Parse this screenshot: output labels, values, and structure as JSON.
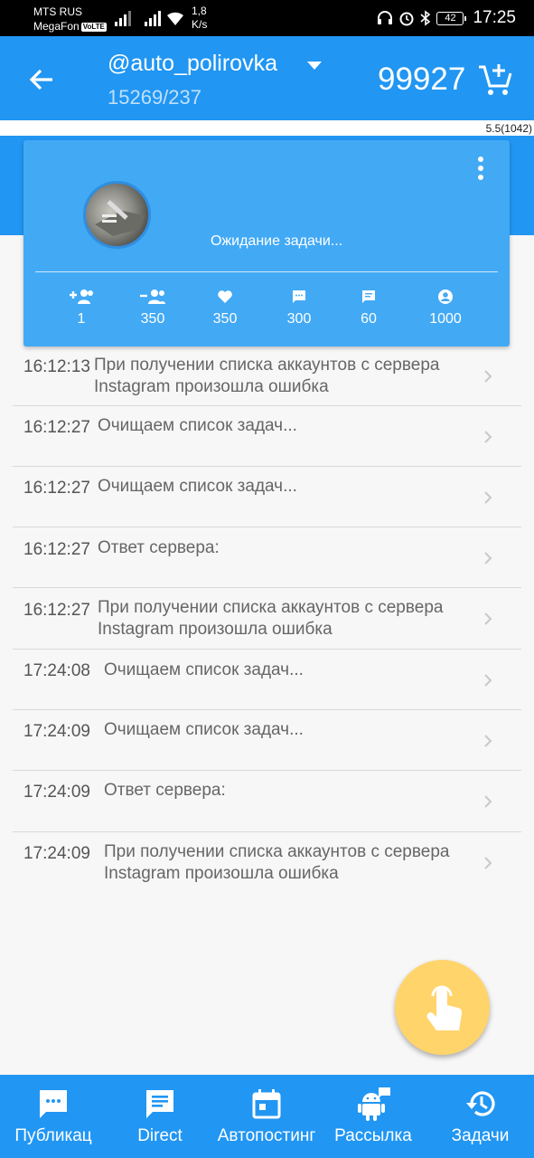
{
  "status_bar": {
    "carrier1": "MTS RUS",
    "carrier2": "MegaFon",
    "volte": "VoLTE",
    "speed_value": "1,8",
    "speed_unit": "K/s",
    "battery": "42",
    "time": "17:25"
  },
  "header": {
    "account": "@auto_polirovka",
    "stats": "15269/237",
    "balance": "99927",
    "version": "5.5(1042)"
  },
  "card": {
    "status": "Ожидание задачи...",
    "stats": [
      {
        "icon": "follow-icon",
        "value": "1"
      },
      {
        "icon": "unfollow-icon",
        "value": "350"
      },
      {
        "icon": "like-icon",
        "value": "350"
      },
      {
        "icon": "comment-icon",
        "value": "300"
      },
      {
        "icon": "message-icon",
        "value": "60"
      },
      {
        "icon": "profile-icon",
        "value": "1000"
      }
    ]
  },
  "log": [
    {
      "time": "16:12:13",
      "msg": "При получении списка аккаунтов с сервера Instagram произошла ошибка"
    },
    {
      "time": "16:12:27",
      "msg": "Очищаем список задач..."
    },
    {
      "time": "16:12:27",
      "msg": "Очищаем список задач..."
    },
    {
      "time": "16:12:27",
      "msg": "Ответ сервера:"
    },
    {
      "time": "16:12:27",
      "msg": "При получении списка аккаунтов с сервера Instagram произошла ошибка"
    },
    {
      "time": "17:24:08",
      "msg": "Очищаем список задач..."
    },
    {
      "time": "17:24:09",
      "msg": "Очищаем список задач..."
    },
    {
      "time": "17:24:09",
      "msg": "Ответ сервера:"
    },
    {
      "time": "17:24:09",
      "msg": "При получении списка аккаунтов с сервера Instagram произошла ошибка"
    }
  ],
  "bottom_nav": [
    {
      "label": "Публикац",
      "icon": "chat-icon"
    },
    {
      "label": "Direct",
      "icon": "direct-icon"
    },
    {
      "label": "Автопостинг",
      "icon": "calendar-icon"
    },
    {
      "label": "Рассылка",
      "icon": "android-icon"
    },
    {
      "label": "Задачи",
      "icon": "history-icon"
    }
  ],
  "colors": {
    "primary": "#2196f3",
    "card": "#42a9f5",
    "fab": "#ffd46b"
  }
}
